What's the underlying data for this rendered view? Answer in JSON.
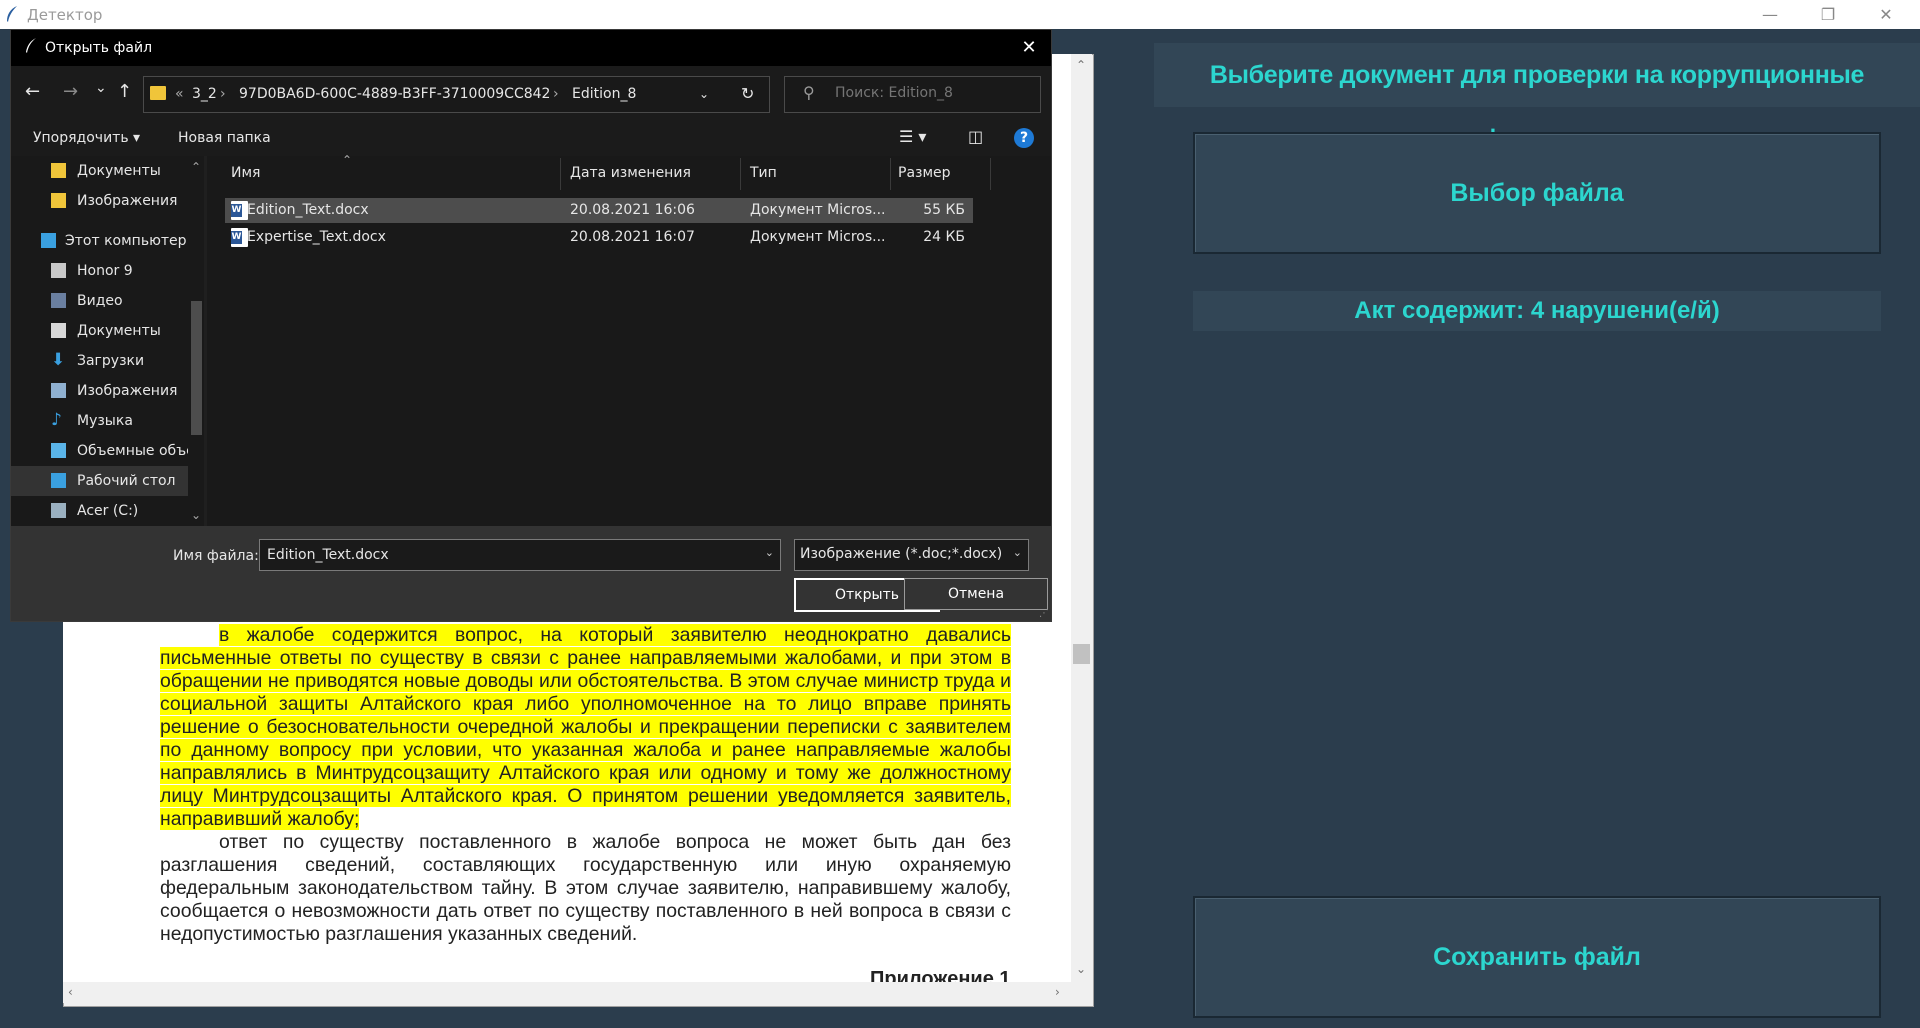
{
  "app": {
    "title": "Детектор",
    "min": "—",
    "max": "❐",
    "close": "✕"
  },
  "right_panel": {
    "header": "Выберите документ для проверки на коррупционные факторы",
    "choose_button": "Выбор файла",
    "status": "Акт содержит: 4 нарушени(е/й)",
    "save_button": "Сохранить файл"
  },
  "document": {
    "paragraphs": [
      "в жалобе содержится вопрос, на который заявителю неоднократно давались письменные ответы по существу в связи с ранее направляемыми жалобами, и при этом в обращении не приводятся новые доводы или обстоятельства. В этом случае министр труда и социальной защиты Алтайского края либо уполномоченное на то лицо вправе принять решение о безосновательности очередной жалобы и прекращении переписки с заявителем по данному вопросу при условии, что указанная жалоба и ранее направляемые жалобы направлялись в Минтрудсоцзащиту Алтайского края или одному и тому же должностному лицу Минтрудсоцзащиты Алтайского края. О принятом решении уведомляется заявитель, направивший жалобу;",
      "ответ по существу поставленного в жалобе вопроса не может быть дан без разглашения сведений, составляющих государственную или иную охраняемую федеральным законодательством тайну. В этом случае заявителю, направившему жалобу, сообщается о невозможности дать ответ по существу поставленного в ней вопроса в связи с недопустимостью разглашения указанных сведений."
    ],
    "appendix": "Приложение 1"
  },
  "dialog": {
    "title": "Открыть файл",
    "close": "✕",
    "nav": {
      "back": "←",
      "forward": "→",
      "recent": "⌄",
      "up": "↑"
    },
    "breadcrumb": [
      "«",
      "3_2",
      "›",
      "97D0BA6D-600C-4889-B3FF-3710009CC842",
      "›",
      "Edition_8"
    ],
    "search_placeholder": "Поиск: Edition_8",
    "toolbar": {
      "organize": "Упорядочить ▾",
      "new_folder": "Новая папка"
    },
    "sidebar": [
      {
        "label": "Документы",
        "icon": "folder-icon"
      },
      {
        "label": "Изображения",
        "icon": "folder-icon"
      },
      {
        "label": "Этот компьютер",
        "icon": "computer-icon"
      },
      {
        "label": "Honor 9",
        "icon": "phone-icon"
      },
      {
        "label": "Видео",
        "icon": "video-icon"
      },
      {
        "label": "Документы",
        "icon": "documents-icon"
      },
      {
        "label": "Загрузки",
        "icon": "download-icon"
      },
      {
        "label": "Изображения",
        "icon": "pictures-icon"
      },
      {
        "label": "Музыка",
        "icon": "music-icon"
      },
      {
        "label": "Объемные объекты",
        "icon": "3d-objects-icon"
      },
      {
        "label": "Рабочий стол",
        "icon": "desktop-icon"
      },
      {
        "label": "Acer (C:)",
        "icon": "drive-icon"
      }
    ],
    "columns": [
      "Имя",
      "Дата изменения",
      "Тип",
      "Размер"
    ],
    "files": [
      {
        "name": "Edition_Text.docx",
        "date": "20.08.2021 16:06",
        "type": "Документ Micros...",
        "size": "55 КБ"
      },
      {
        "name": "Expertise_Text.docx",
        "date": "20.08.2021 16:07",
        "type": "Документ Micros...",
        "size": "24 КБ"
      }
    ],
    "filename_label": "Имя файла:",
    "filename_value": "Edition_Text.docx",
    "filetype": "Изображение (*.doc;*.docx)",
    "open": "Открыть",
    "cancel": "Отмена"
  }
}
